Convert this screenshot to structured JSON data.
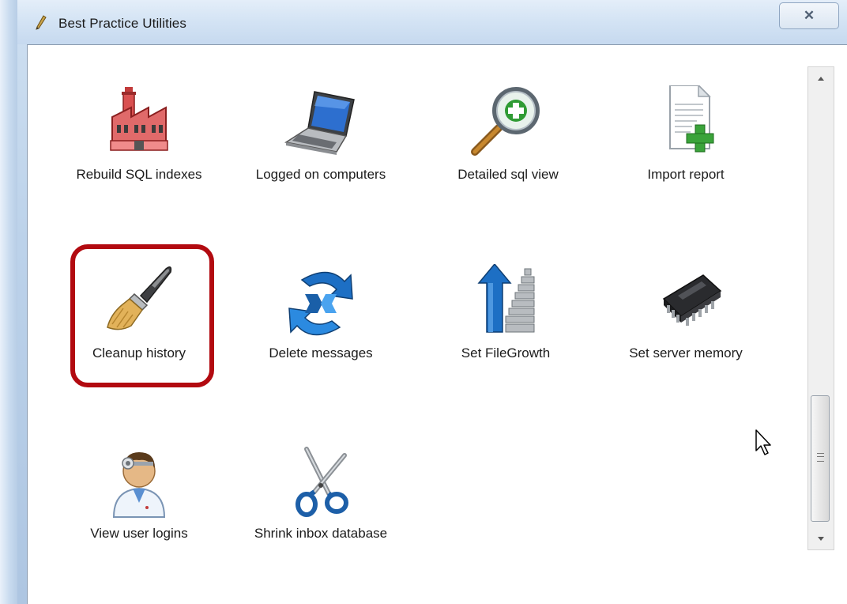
{
  "window": {
    "title": "Best Practice Utilities",
    "close_glyph": "✕"
  },
  "utilities": [
    {
      "label": "Rebuild SQL indexes",
      "icon": "factory-icon"
    },
    {
      "label": "Logged on computers",
      "icon": "laptop-icon"
    },
    {
      "label": "Detailed sql view",
      "icon": "magnifier-plus-icon"
    },
    {
      "label": "Import report",
      "icon": "document-add-icon"
    },
    {
      "label": "Cleanup history",
      "icon": "paintbrush-icon",
      "highlighted": true
    },
    {
      "label": "Delete messages",
      "icon": "recycle-arrows-icon"
    },
    {
      "label": "Set FileGrowth",
      "icon": "growth-arrow-icon"
    },
    {
      "label": "Set server memory",
      "icon": "memory-chip-icon"
    },
    {
      "label": "View user logins",
      "icon": "doctor-user-icon"
    },
    {
      "label": "Shrink inbox database",
      "icon": "scissors-icon"
    }
  ],
  "colors": {
    "highlight": "#b20a10",
    "accent_green": "#3aa33a",
    "accent_blue": "#1d6fc4"
  }
}
